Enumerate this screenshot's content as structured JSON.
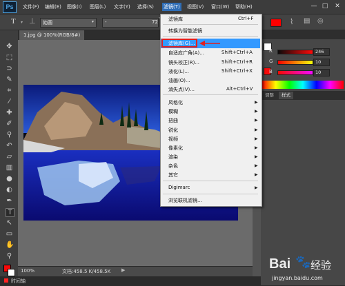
{
  "app": {
    "logo": "Ps"
  },
  "menubar": {
    "items": [
      "文件(F)",
      "编辑(E)",
      "图像(I)",
      "图层(L)",
      "文字(Y)",
      "选择(S)",
      "滤镜(T)",
      "视图(V)",
      "窗口(W)",
      "帮助(H)"
    ],
    "active_index": 6,
    "window_buttons": [
      "—",
      "□",
      "✕"
    ]
  },
  "options_bar": {
    "tool_glyph": "T",
    "font_family": "幼圆",
    "font_style": "-",
    "size_text": "72"
  },
  "document": {
    "tab": "1.jpg @ 100%(RGB/8#)",
    "zoom": "100%",
    "doc_info": "文档:458.5 K/458.5K"
  },
  "bottom": {
    "label": "时间轴"
  },
  "color_panel": {
    "channels": [
      {
        "label": "R",
        "value": "246"
      },
      {
        "label": "G",
        "value": "10"
      },
      {
        "label": "B",
        "value": "10"
      }
    ],
    "swatch_color": "#f60a0a"
  },
  "panels": {
    "tab_styles": "样式",
    "tab_adjust": "调整"
  },
  "filter_menu": {
    "items": [
      {
        "label": "滤镜库",
        "shortcut": "Ctrl+F"
      },
      {
        "label": "转换为智能滤镜",
        "shortcut": ""
      },
      {
        "label": "滤镜库(G)...",
        "shortcut": "",
        "highlighted": true
      },
      {
        "label": "自适应广角(A)...",
        "shortcut": "Shift+Ctrl+A"
      },
      {
        "label": "镜头校正(R)...",
        "shortcut": "Shift+Ctrl+R"
      },
      {
        "label": "液化(L)...",
        "shortcut": "Shift+Ctrl+X"
      },
      {
        "label": "油画(O)...",
        "shortcut": ""
      },
      {
        "label": "消失点(V)...",
        "shortcut": "Alt+Ctrl+V"
      },
      {
        "label": "风格化",
        "submenu": true
      },
      {
        "label": "模糊",
        "submenu": true
      },
      {
        "label": "扭曲",
        "submenu": true
      },
      {
        "label": "锐化",
        "submenu": true
      },
      {
        "label": "视频",
        "submenu": true
      },
      {
        "label": "像素化",
        "submenu": true
      },
      {
        "label": "渲染",
        "submenu": true
      },
      {
        "label": "杂色",
        "submenu": true
      },
      {
        "label": "其它",
        "submenu": true
      },
      {
        "label": "Digimarc",
        "submenu": true
      },
      {
        "label": "浏览联机滤镜..."
      }
    ]
  },
  "watermark": {
    "brand": "Bai",
    "brand2": "经验",
    "url": "jingyan.baidu.com"
  },
  "colors": {
    "accent": "#3399ff",
    "highlight_box": "#e02020",
    "menubar": "#3c3c3c",
    "panel": "#474747"
  }
}
